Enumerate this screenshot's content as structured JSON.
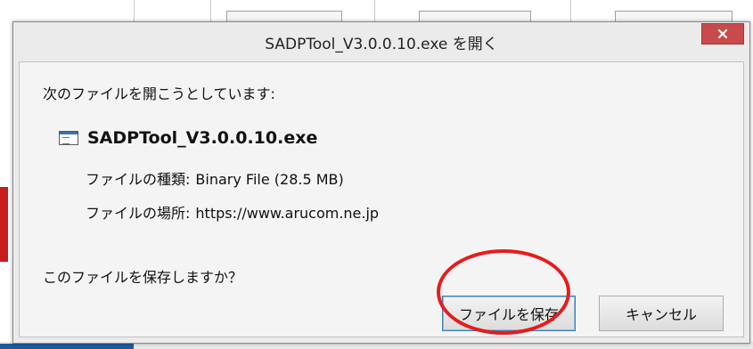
{
  "dialog": {
    "title": "SADPTool_V3.0.0.10.exe を開く",
    "close_icon": "close-icon",
    "prompt": "次のファイルを開こうとしています:",
    "file": {
      "icon": "executable-file-icon",
      "name": "SADPTool_V3.0.0.10.exe",
      "type_label": "ファイルの種類:",
      "type_value": "Binary File (28.5 MB)",
      "location_label": "ファイルの場所:",
      "location_value": "https://www.arucom.ne.jp"
    },
    "question": "このファイルを保存しますか？",
    "buttons": {
      "save_label": "ファイルを保存",
      "cancel_label": "キャンセル"
    }
  },
  "colors": {
    "close_button": "#c84a4a",
    "annotation_circle": "#e41d1d",
    "save_button_border": "#3c7fb1"
  }
}
